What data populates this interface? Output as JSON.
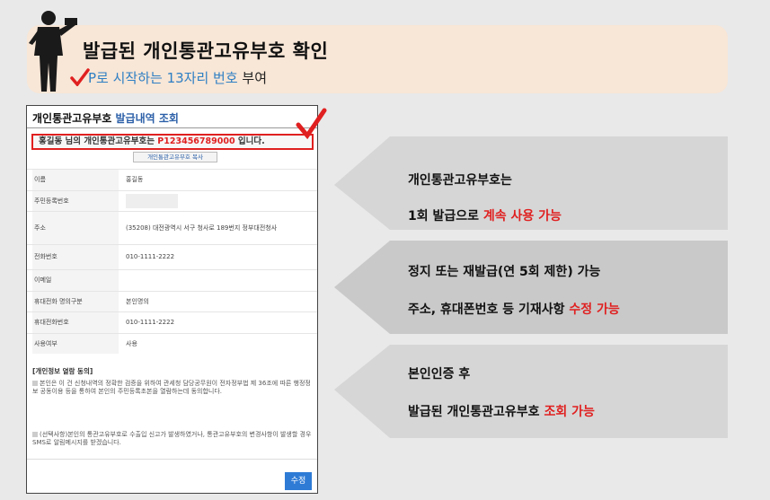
{
  "header": {
    "title": "발급된  개인통관고유부호  확인",
    "sub_blue": "P로 시작하는 13자리 번호",
    "sub_dark": " 부여"
  },
  "panel": {
    "title_dark": "개인통관고유부호 ",
    "title_blue": "발급내역 조회",
    "highlight_pre": "홍길동 님의 개인통관고유부호는  ",
    "highlight_code": "P123456789000",
    "highlight_post": " 입니다.",
    "copy_label": "개인통관고유부호 복사",
    "rows": [
      {
        "label": "이름",
        "value": "홍길동"
      },
      {
        "label": "주민등록번호",
        "value": ""
      },
      {
        "label": "주소",
        "value": "(35208) 대전광역시 서구 청사로 189번지 정부대전청사"
      },
      {
        "label": "전화번호",
        "value": "010-1111-2222"
      },
      {
        "label": "이메일",
        "value": ""
      },
      {
        "label": "휴대전화 명의구분",
        "value": "본인명의"
      },
      {
        "label": "휴대전화번호",
        "value": "010-1111-2222"
      },
      {
        "label": "사용여부",
        "value": "사용"
      }
    ],
    "consent_title": "[개인정보 열람 동의]",
    "consent_1": "본인은 이 건 신청내역의 정확한 검증을 위하여 관세청 담당공무원이 전자정부법 제 36조에 따른 행정정보 공동이용 등을 통하여 본인의 주민등록초본을 열람하는데 동의합니다.",
    "consent_2": "(선택사항)본인의 통관고유부호로 수출입 신고가 발생하였거나, 통관고유부호의 변경사항이 발생할 경우 SMS로 알림메시지를 받겠습니다.",
    "edit_label": "수정"
  },
  "callouts": [
    {
      "line1": "개인통관고유부호는",
      "line2_pre": "1회 발급으로 ",
      "line2_red": "계속 사용 가능"
    },
    {
      "line1": "정지 또는 재발급(연 5회 제한) 가능",
      "line2_pre": "주소, 휴대폰번호 등 기재사항 ",
      "line2_red": "수정 가능"
    },
    {
      "line1": "본인인증 후",
      "line2_pre": "발급된 개인통관고유부호 ",
      "line2_red": "조회 가능"
    }
  ],
  "colors": {
    "accent_red": "#e02020",
    "accent_blue": "#2e7fc4",
    "header_bg": "#f8e6d6",
    "callout_bg": "#d4d4d4"
  }
}
